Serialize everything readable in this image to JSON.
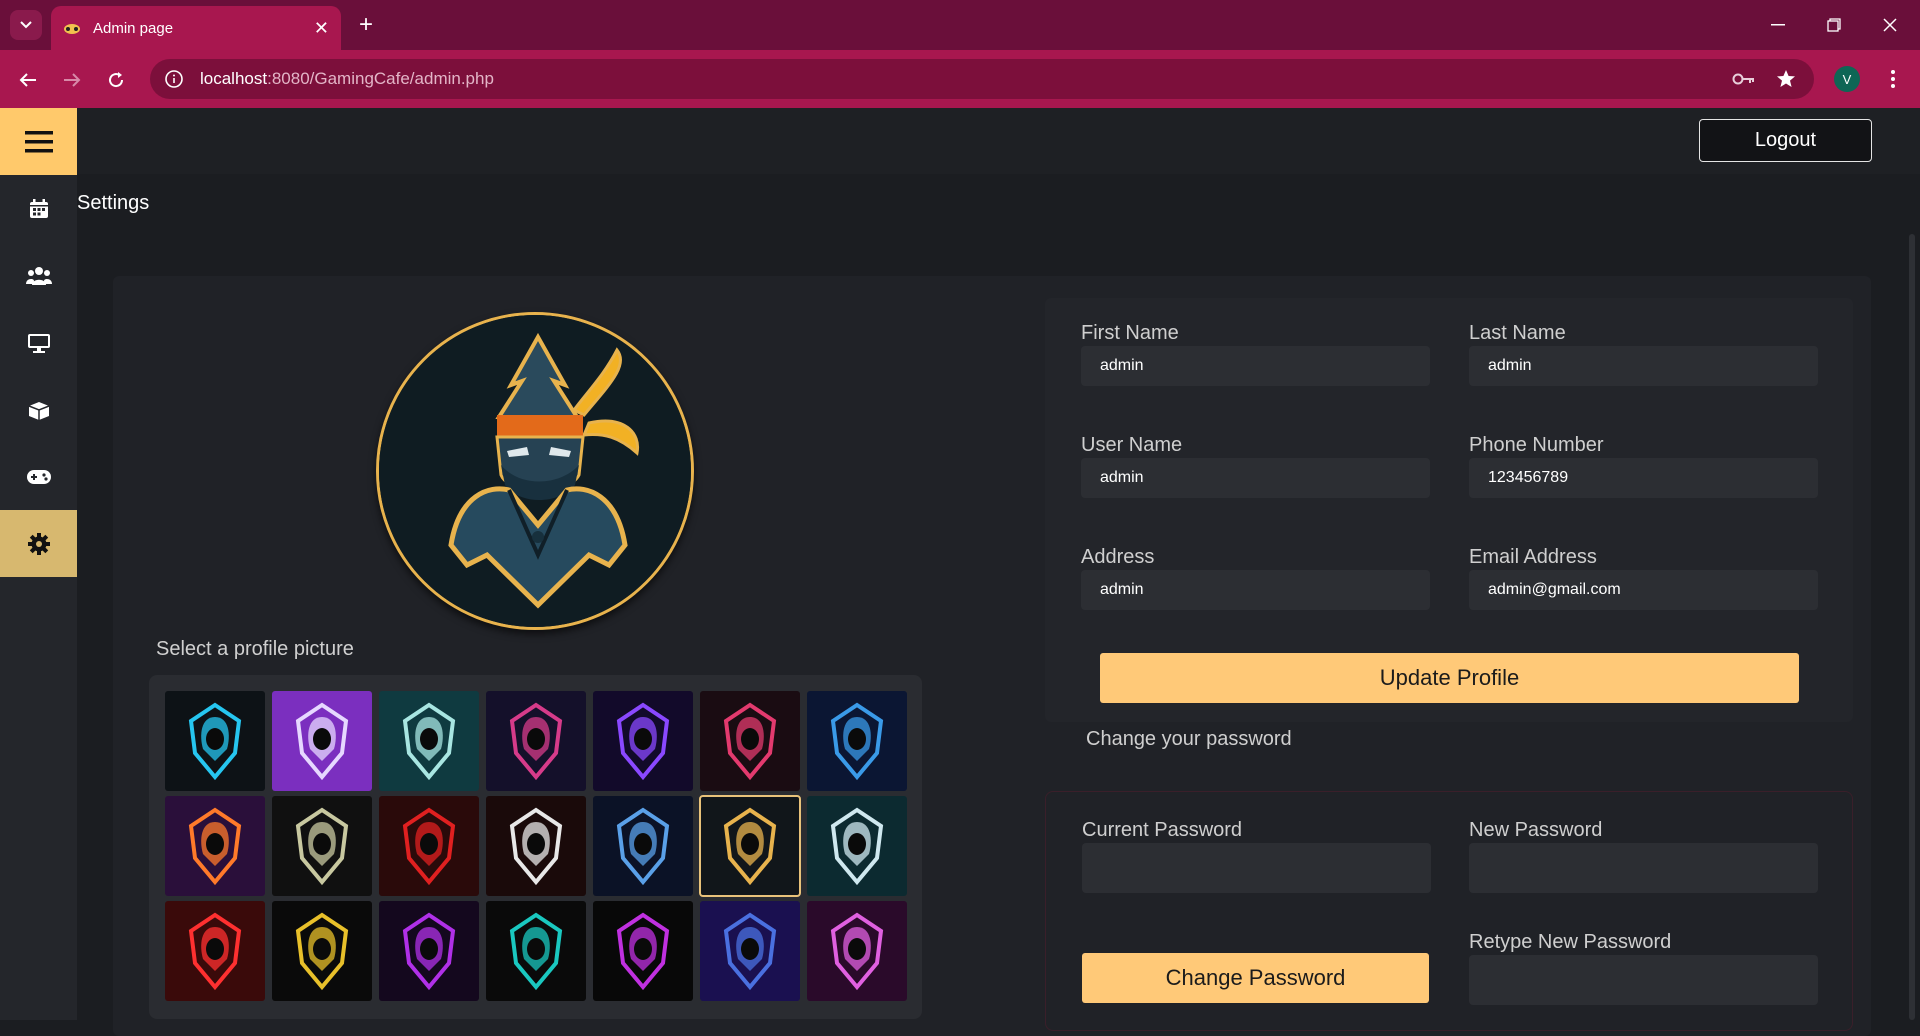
{
  "browser": {
    "tab_title": "Admin page",
    "url_host": "localhost",
    "url_rest": ":8080/GamingCafe/admin.php",
    "profile_initial": "V"
  },
  "sidebar": {
    "items": [
      {
        "icon": "menu-icon",
        "active": false
      },
      {
        "icon": "calendar-icon",
        "active": false
      },
      {
        "icon": "users-icon",
        "active": false
      },
      {
        "icon": "monitor-icon",
        "active": false
      },
      {
        "icon": "box-icon",
        "active": false
      },
      {
        "icon": "gamepad-icon",
        "active": false
      },
      {
        "icon": "gear-icon",
        "active": true
      }
    ]
  },
  "header": {
    "logout_label": "Logout",
    "page_title": "Settings"
  },
  "profile": {
    "select_label": "Select a profile picture",
    "thumbs": [
      {
        "bg": "#0d1216",
        "fg": "#26c6f0",
        "selected": false
      },
      {
        "bg": "#7b2fbf",
        "fg": "#e6d8ff",
        "selected": false
      },
      {
        "bg": "#0f3a40",
        "fg": "#a8e6e2",
        "selected": false
      },
      {
        "bg": "#14102a",
        "fg": "#d63b8a",
        "selected": false
      },
      {
        "bg": "#120a2a",
        "fg": "#8a48ff",
        "selected": false
      },
      {
        "bg": "#1a0c12",
        "fg": "#e33a6e",
        "selected": false
      },
      {
        "bg": "#0b1633",
        "fg": "#3a9ae8",
        "selected": false
      },
      {
        "bg": "#2a0f3a",
        "fg": "#ff7a2a",
        "selected": false
      },
      {
        "bg": "#101010",
        "fg": "#c8c8a0",
        "selected": false
      },
      {
        "bg": "#2a0a0a",
        "fg": "#e02020",
        "selected": false
      },
      {
        "bg": "#1a0a0a",
        "fg": "#e8e8e8",
        "selected": false
      },
      {
        "bg": "#0b1226",
        "fg": "#5aa0e8",
        "selected": false
      },
      {
        "bg": "#11161a",
        "fg": "#e8b34d",
        "selected": true
      },
      {
        "bg": "#0c2a30",
        "fg": "#cfe8ef",
        "selected": false
      },
      {
        "bg": "#3a0a0a",
        "fg": "#ff3030",
        "selected": false
      },
      {
        "bg": "#0a0a0a",
        "fg": "#e8c02a",
        "selected": false
      },
      {
        "bg": "#14081e",
        "fg": "#b030e8",
        "selected": false
      },
      {
        "bg": "#0a0a0a",
        "fg": "#1ac8c0",
        "selected": false
      },
      {
        "bg": "#080808",
        "fg": "#c030e0",
        "selected": false
      },
      {
        "bg": "#1a1050",
        "fg": "#4a70e0",
        "selected": false
      },
      {
        "bg": "#2a0a2a",
        "fg": "#e060e0",
        "selected": false
      }
    ]
  },
  "form": {
    "first_name": {
      "label": "First Name",
      "value": "admin"
    },
    "last_name": {
      "label": "Last Name",
      "value": "admin"
    },
    "user_name": {
      "label": "User Name",
      "value": "admin"
    },
    "phone": {
      "label": "Phone Number",
      "value": "123456789"
    },
    "address": {
      "label": "Address",
      "value": "admin"
    },
    "email": {
      "label": "Email Address",
      "value": "admin@gmail.com"
    },
    "update_label": "Update Profile"
  },
  "password": {
    "heading": "Change your password",
    "current_label": "Current Password",
    "new_label": "New Password",
    "retype_label": "Retype New Password",
    "change_label": "Change Password"
  },
  "colors": {
    "accent": "#ffc978",
    "sidebar_active": "#d7b86f",
    "chrome": "#a8174f"
  }
}
